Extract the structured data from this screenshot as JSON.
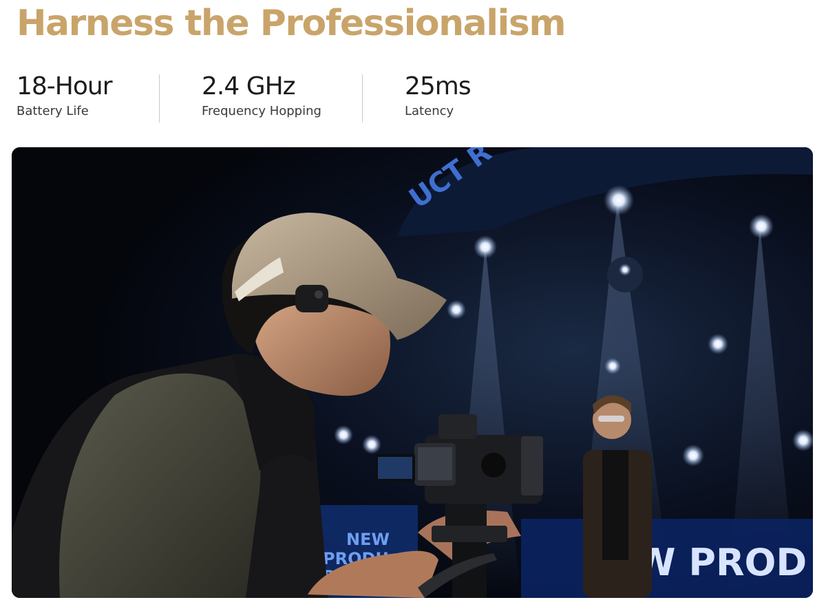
{
  "headline": "Harness the Professionalism",
  "specs": [
    {
      "value": "18-Hour",
      "label": "Battery Life"
    },
    {
      "value": "2.4 GHz",
      "label": "Frequency Hopping"
    },
    {
      "value": "25ms",
      "label": "Latency"
    }
  ],
  "photo": {
    "backdrop_text_top": "UCT R",
    "backdrop_text_left_1": "NEW",
    "backdrop_text_left_2": "PRODU",
    "backdrop_text_left_3": "RELE",
    "backdrop_text_right": "W PROD"
  },
  "colors": {
    "headline": "#c9a46a",
    "spec_value": "#1c1c1c",
    "divider": "#c8c8c8"
  }
}
